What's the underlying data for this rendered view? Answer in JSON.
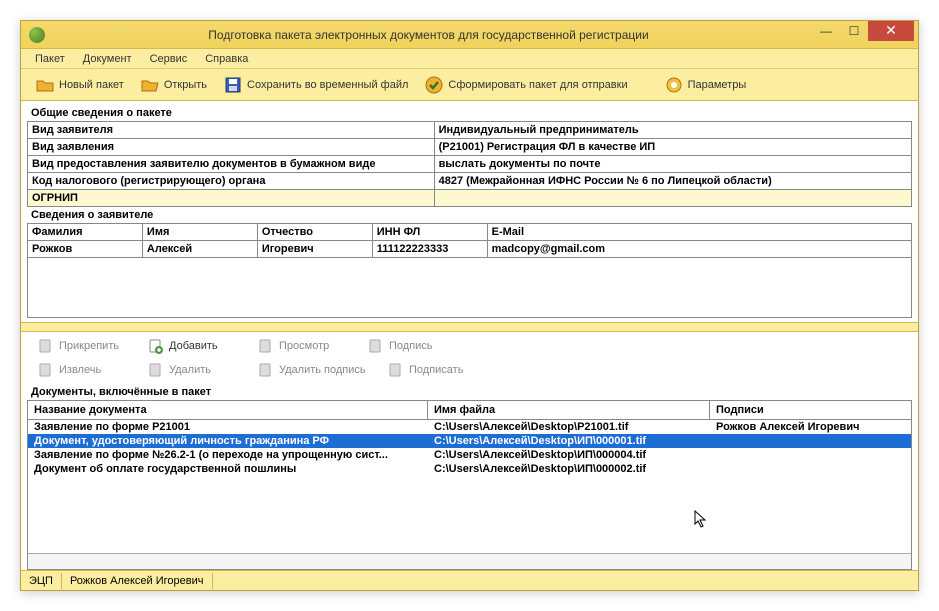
{
  "window": {
    "title": "Подготовка пакета электронных документов для государственной регистрации"
  },
  "menus": [
    "Пакет",
    "Документ",
    "Сервис",
    "Справка"
  ],
  "toolbar": [
    {
      "id": "new-pack",
      "label": "Новый пакет"
    },
    {
      "id": "open",
      "label": "Открыть"
    },
    {
      "id": "save-temp",
      "label": "Сохранить во временный файл"
    },
    {
      "id": "form-pack",
      "label": "Сформировать пакет для отправки"
    },
    {
      "id": "params",
      "label": "Параметры"
    }
  ],
  "panelTitles": {
    "general": "Общие сведения о пакете",
    "applicant": "Сведения о заявителе",
    "docs": "Документы, включённые в пакет"
  },
  "general": [
    {
      "label": "Вид заявителя",
      "value": "Индивидуальный предприниматель"
    },
    {
      "label": "Вид заявления",
      "value": "(Р21001) Регистрация ФЛ в качестве ИП"
    },
    {
      "label": "Вид предоставления заявителю документов в бумажном виде",
      "value": "выслать документы по почте"
    },
    {
      "label": "Код налогового (регистрирующего) органа",
      "value": "4827 (Межрайонная ИФНС России № 6 по Липецкой области)"
    },
    {
      "label": "ОГРНИП",
      "value": ""
    }
  ],
  "applicantHeaders": [
    "Фамилия",
    "Имя",
    "Отчество",
    "ИНН ФЛ",
    "E-Mail"
  ],
  "applicant": {
    "lastname": "Рожков",
    "firstname": "Алексей",
    "middlename": "Игоревич",
    "inn": "111122223333",
    "email": "madcopy@gmail.com"
  },
  "docToolbar": {
    "attach": "Прикрепить",
    "add": "Добавить",
    "view": "Просмотр",
    "sign": "Подпись",
    "extract": "Извлечь",
    "delete": "Удалить",
    "delsign": "Удалить подпись",
    "dosign": "Подписать"
  },
  "docColumns": {
    "name": "Название документа",
    "file": "Имя файла",
    "signs": "Подписи"
  },
  "docs": [
    {
      "name": "Заявление по форме Р21001",
      "file": "C:\\Users\\Алексей\\Desktop\\P21001.tif",
      "sign": "Рожков Алексей Игоревич",
      "sel": false
    },
    {
      "name": "Документ, удостоверяющий личность гражданина РФ",
      "file": "C:\\Users\\Алексей\\Desktop\\ИП\\000001.tif",
      "sign": "",
      "sel": true
    },
    {
      "name": "Заявление по форме №26.2-1 (о переходе на упрощенную сист...",
      "file": "C:\\Users\\Алексей\\Desktop\\ИП\\000004.tif",
      "sign": "",
      "sel": false
    },
    {
      "name": "Документ об оплате государственной пошлины",
      "file": "C:\\Users\\Алексей\\Desktop\\ИП\\000002.tif",
      "sign": "",
      "sel": false
    }
  ],
  "status": {
    "ecp": "ЭЦП",
    "signer": "Рожков Алексей Игоревич"
  }
}
